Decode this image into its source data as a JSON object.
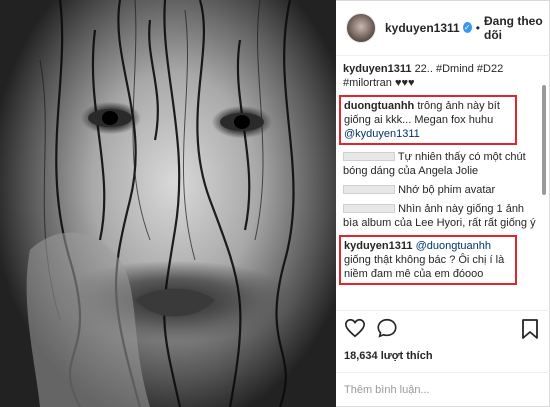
{
  "post": {
    "image_alt_name": "black-and-white wet face portrait"
  },
  "header": {
    "username": "kyduyen1311",
    "verified_glyph": "✓",
    "separator": "•",
    "follow_label": "Đang theo dõi"
  },
  "comments": [
    {
      "username": "kyduyen1311",
      "text": "22.. #Dmind #D22 #milortran",
      "hearts": "♥♥♥"
    },
    {
      "username": "duongtuanhh",
      "text": "trông ảnh này bít giống ai kkk... Megan fox huhu ",
      "mention": "@kyduyen1311",
      "highlighted": true
    },
    {
      "username": "",
      "text": "Tự nhiên thấy có một chút bóng dáng của Angela Jolie",
      "redacted": true
    },
    {
      "username": "",
      "text": "Nhớ bộ phim avatar",
      "redacted": true
    },
    {
      "username": "",
      "text": "Nhìn ảnh này giống 1 ảnh bìa album của Lee Hyori, rất rất giống ý",
      "redacted": true
    },
    {
      "username": "kyduyen1311",
      "mention": "@duongtuanhh",
      "text": " giống thật không bác ? Ôi chị í là niềm đam mê của em đóooo",
      "highlighted": true
    }
  ],
  "actions": {
    "like_icon": "heart-outline-icon",
    "comment_icon": "comment-bubble-icon",
    "save_icon": "bookmark-icon"
  },
  "likes": {
    "text": "18,634 lượt thích"
  },
  "comment_box": {
    "placeholder": "Thêm bình luận..."
  },
  "colors": {
    "highlight_border": "#e0262d",
    "verified_blue": "#3897f0",
    "link_blue": "#003569"
  }
}
